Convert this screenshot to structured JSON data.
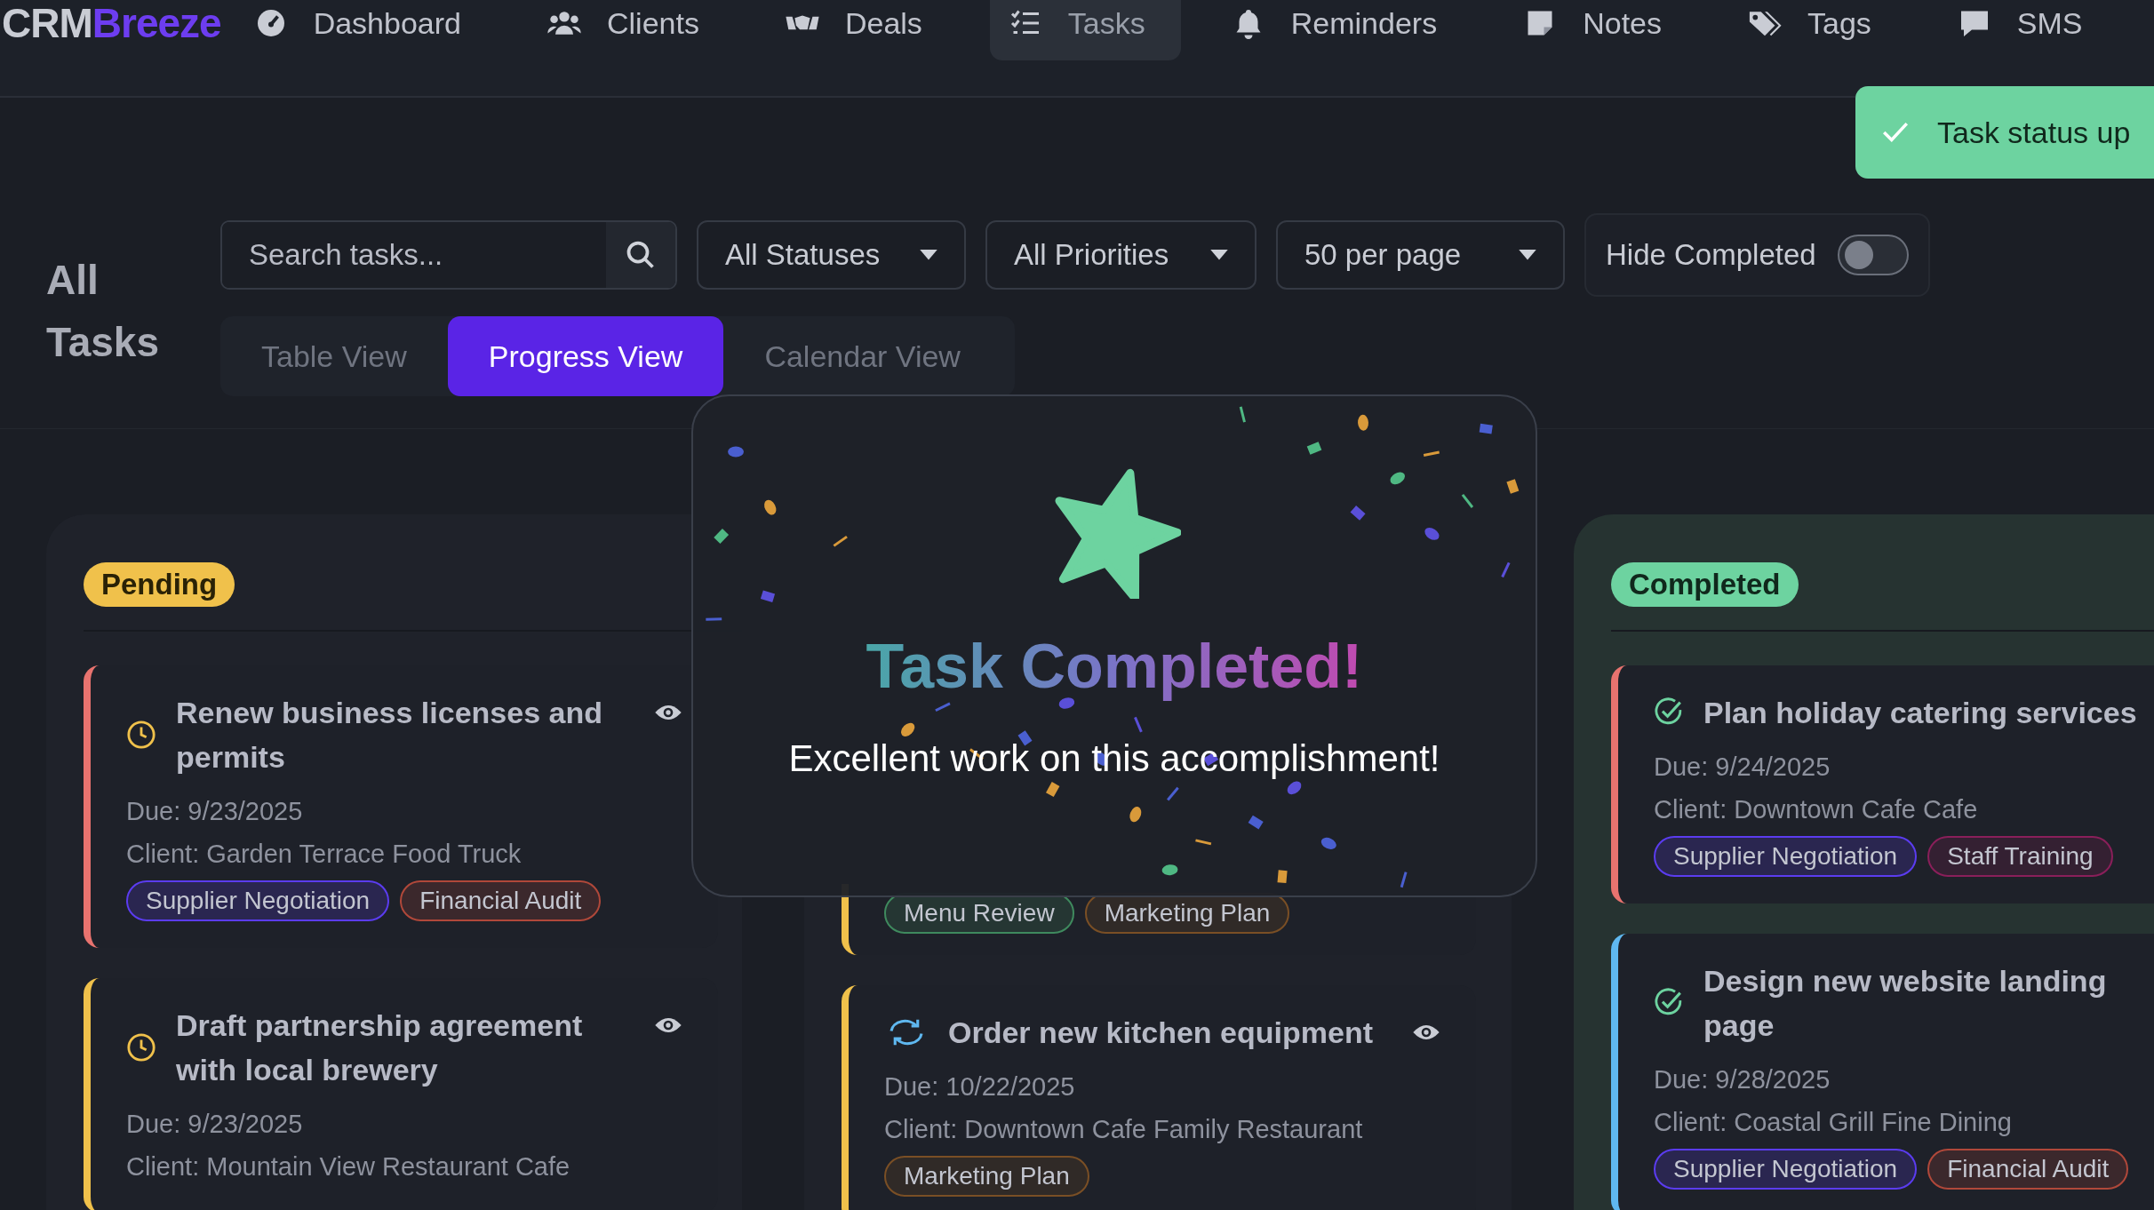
{
  "nav": {
    "logo": [
      "CRM",
      "Breeze"
    ],
    "items": [
      {
        "label": "Dashboard",
        "selected": false
      },
      {
        "label": "Clients",
        "selected": false
      },
      {
        "label": "Deals",
        "selected": false
      },
      {
        "label": "Tasks",
        "selected": true
      },
      {
        "label": "Reminders",
        "selected": false
      },
      {
        "label": "Notes",
        "selected": false
      },
      {
        "label": "Tags",
        "selected": false
      },
      {
        "label": "SMS",
        "selected": false
      }
    ]
  },
  "page_title": "All Tasks",
  "filters": {
    "search": {
      "placeholder": "Search tasks..."
    },
    "dropdowns": [
      "All Statuses",
      "All Priorities",
      "50 per page"
    ],
    "toggle": {
      "label": "Hide Completed",
      "on": false
    }
  },
  "views": [
    {
      "label": "Table View",
      "selected": false
    },
    {
      "label": "Progress View",
      "selected": true
    },
    {
      "label": "Calendar View",
      "selected": false
    }
  ],
  "columns": [
    {
      "kind": "pending",
      "title": "Pending",
      "cards": [
        {
          "color": "#e8736f",
          "title": "Renew business licenses and permits",
          "due": "Due: 9/23/2025",
          "client": "Client: Garden Terrace Food Truck",
          "tags": [
            {
              "label": "Supplier Negotiation",
              "color": "#5b3cf0"
            },
            {
              "label": "Financial Audit",
              "color": "#b0483a"
            }
          ]
        },
        {
          "color": "#f0c14b",
          "title": "Draft partnership agreement with local brewery",
          "due": "Due: 9/23/2025",
          "client": "Client: Mountain View Restaurant Cafe"
        }
      ]
    },
    {
      "kind": "in_progress",
      "cards": [
        {
          "color": "#f0c14b",
          "tags": [
            {
              "label": "Menu Review",
              "color": "#3f8a5e"
            },
            {
              "label": "Marketing Plan",
              "color": "#7a4f25"
            }
          ]
        },
        {
          "color": "#f0c14b",
          "title": "Order new kitchen equipment",
          "due": "Due: 10/22/2025",
          "client": "Client: Downtown Cafe Family Restaurant",
          "tags": [
            {
              "label": "Marketing Plan",
              "color": "#7a4f25"
            }
          ]
        }
      ]
    },
    {
      "kind": "completed",
      "title": "Completed",
      "cards": [
        {
          "color": "#e8736f",
          "title": "Plan holiday catering services",
          "due": "Due: 9/24/2025",
          "client": "Client: Downtown Cafe Cafe",
          "tags": [
            {
              "label": "Supplier Negotiation",
              "color": "#5b3cf0"
            },
            {
              "label": "Staff Training",
              "color": "#8a1f5a"
            }
          ]
        },
        {
          "color": "#5fb8f0",
          "title": "Design new website landing page",
          "due": "Due: 9/28/2025",
          "client": "Client: Coastal Grill Fine Dining",
          "tags": [
            {
              "label": "Supplier Negotiation",
              "color": "#5b3cf0"
            },
            {
              "label": "Financial Audit",
              "color": "#b0483a"
            }
          ]
        }
      ]
    }
  ],
  "modal": {
    "title": "Task Completed!",
    "message": "Excellent work on this accomplishment!"
  },
  "toast": {
    "message": "Task status up"
  }
}
